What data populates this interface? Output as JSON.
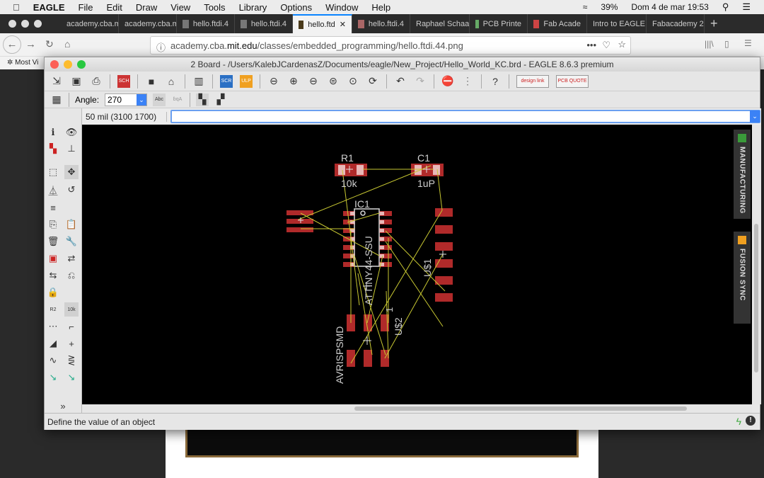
{
  "menubar": {
    "app": "EAGLE",
    "items": [
      "File",
      "Edit",
      "Draw",
      "View",
      "Tools",
      "Library",
      "Options",
      "Window",
      "Help"
    ],
    "battery": "39%",
    "datetime": "Dom 4 de mar  19:53"
  },
  "browser": {
    "tabs": [
      "academy.cba.m",
      "academy.cba.m",
      "hello.ftdi.4",
      "hello.ftdi.4",
      "hello.ftd",
      "hello.ftdi.4",
      "Raphael Schaa",
      "PCB Printe",
      "Fab Acade",
      "Intro to EAGLE",
      "Fabacademy 2"
    ],
    "active_tab": 4,
    "url_prefix": "academy.cba.",
    "url_domain": "mit.edu",
    "url_path": "/classes/embedded_programming/hello.ftdi.44.png",
    "bookmark": "Most Vi"
  },
  "eagle": {
    "title": "2 Board - /Users/KalebJCardenasZ/Documents/eagle/New_Project/Hello_World_KC.brd - EAGLE 8.6.3 premium",
    "angle_label": "Angle:",
    "angle_value": "270",
    "grid_readout": "50 mil (3100 1700)",
    "command_value": "",
    "side_tabs": {
      "manufacturing": "MANUFACTURING",
      "fusion": "FUSION SYNC"
    },
    "status": "Define the value of an object",
    "toolbar": {
      "sch": "SCH",
      "scr": "SCR",
      "ulp": "ULP",
      "designlink": "design link",
      "pcbquote": "PCB QUOTE"
    }
  },
  "board": {
    "parts": {
      "r1": {
        "name": "R1",
        "value": "10k"
      },
      "c1": {
        "name": "C1",
        "value": "1uP"
      },
      "ic1": {
        "name": "IC1",
        "value": "ATTINY44-SSU"
      },
      "us1": {
        "name": "U$1"
      },
      "us2": {
        "name": "U$2",
        "value": "AVRISPSMD",
        "pin1": "1"
      }
    },
    "colors": {
      "pad": "#b02a2a",
      "airwire": "#c8c832",
      "outline": "#d8d8d8",
      "background": "#000000"
    }
  }
}
